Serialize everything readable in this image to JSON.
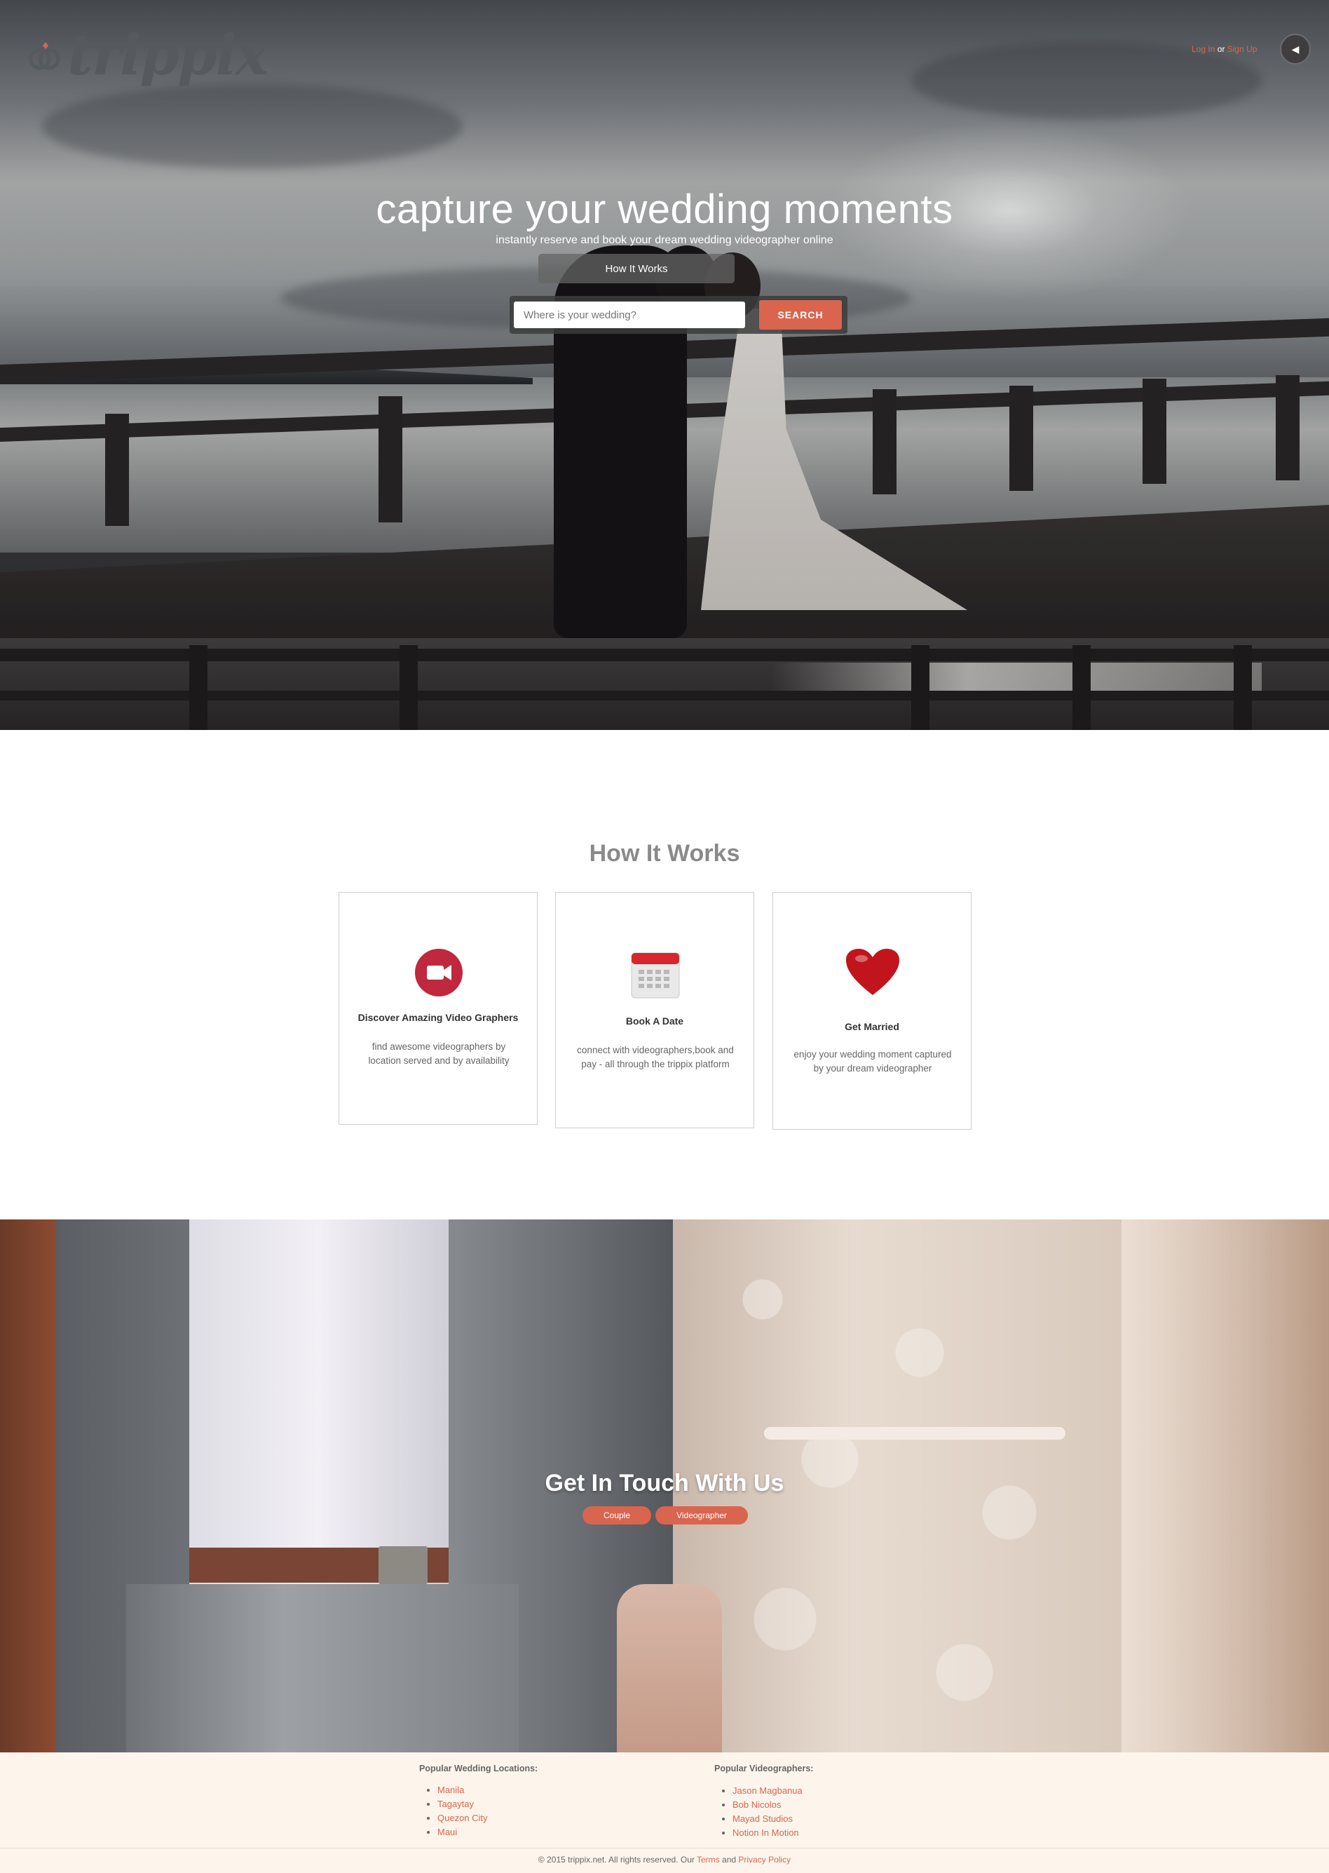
{
  "header": {
    "brand": "trippix",
    "auth": {
      "login_label": "Log In",
      "separator": "or",
      "signup_label": "Sign Up"
    },
    "mute_icon": "speaker-icon"
  },
  "hero": {
    "title": "capture your wedding moments",
    "subtitle": "instantly reserve and book your dream wedding videographer online",
    "how_it_works_button": "How It Works",
    "search": {
      "placeholder": "Where is your wedding?",
      "button_label": "SEARCH"
    }
  },
  "how_it_works": {
    "title": "How It Works",
    "cards": [
      {
        "icon": "video-camera-icon",
        "title": "Discover Amazing Video Graphers",
        "description": "find awesome videographers by location served and by availability"
      },
      {
        "icon": "calendar-icon",
        "title": "Book A Date",
        "description": "connect with videographers,book and pay - all through the trippix platform"
      },
      {
        "icon": "heart-icon",
        "title": "Get Married",
        "description": "enjoy your wedding moment captured by your dream videographer"
      }
    ]
  },
  "get_in_touch": {
    "title": "Get In Touch With Us",
    "buttons": [
      "Couple",
      "Videographer"
    ]
  },
  "footer": {
    "locations": {
      "heading": "Popular Wedding Locations:",
      "items": [
        "Manila",
        "Tagaytay",
        "Quezon City",
        "Maui"
      ]
    },
    "videographers": {
      "heading": "Popular Videographers:",
      "items": [
        "Jason Magbanua",
        "Bob Nicolos",
        "Mayad Studios",
        "Notion In Motion"
      ]
    },
    "copyright": {
      "prefix": "© 2015 trippix.net. All rights reserved. Our",
      "terms_label": "Terms",
      "and": "and",
      "privacy_label": "Privacy Policy"
    }
  },
  "colors": {
    "accent": "#d9654f",
    "footer_bg": "#fdf5ec",
    "heading_gray": "#8a8a8a"
  }
}
